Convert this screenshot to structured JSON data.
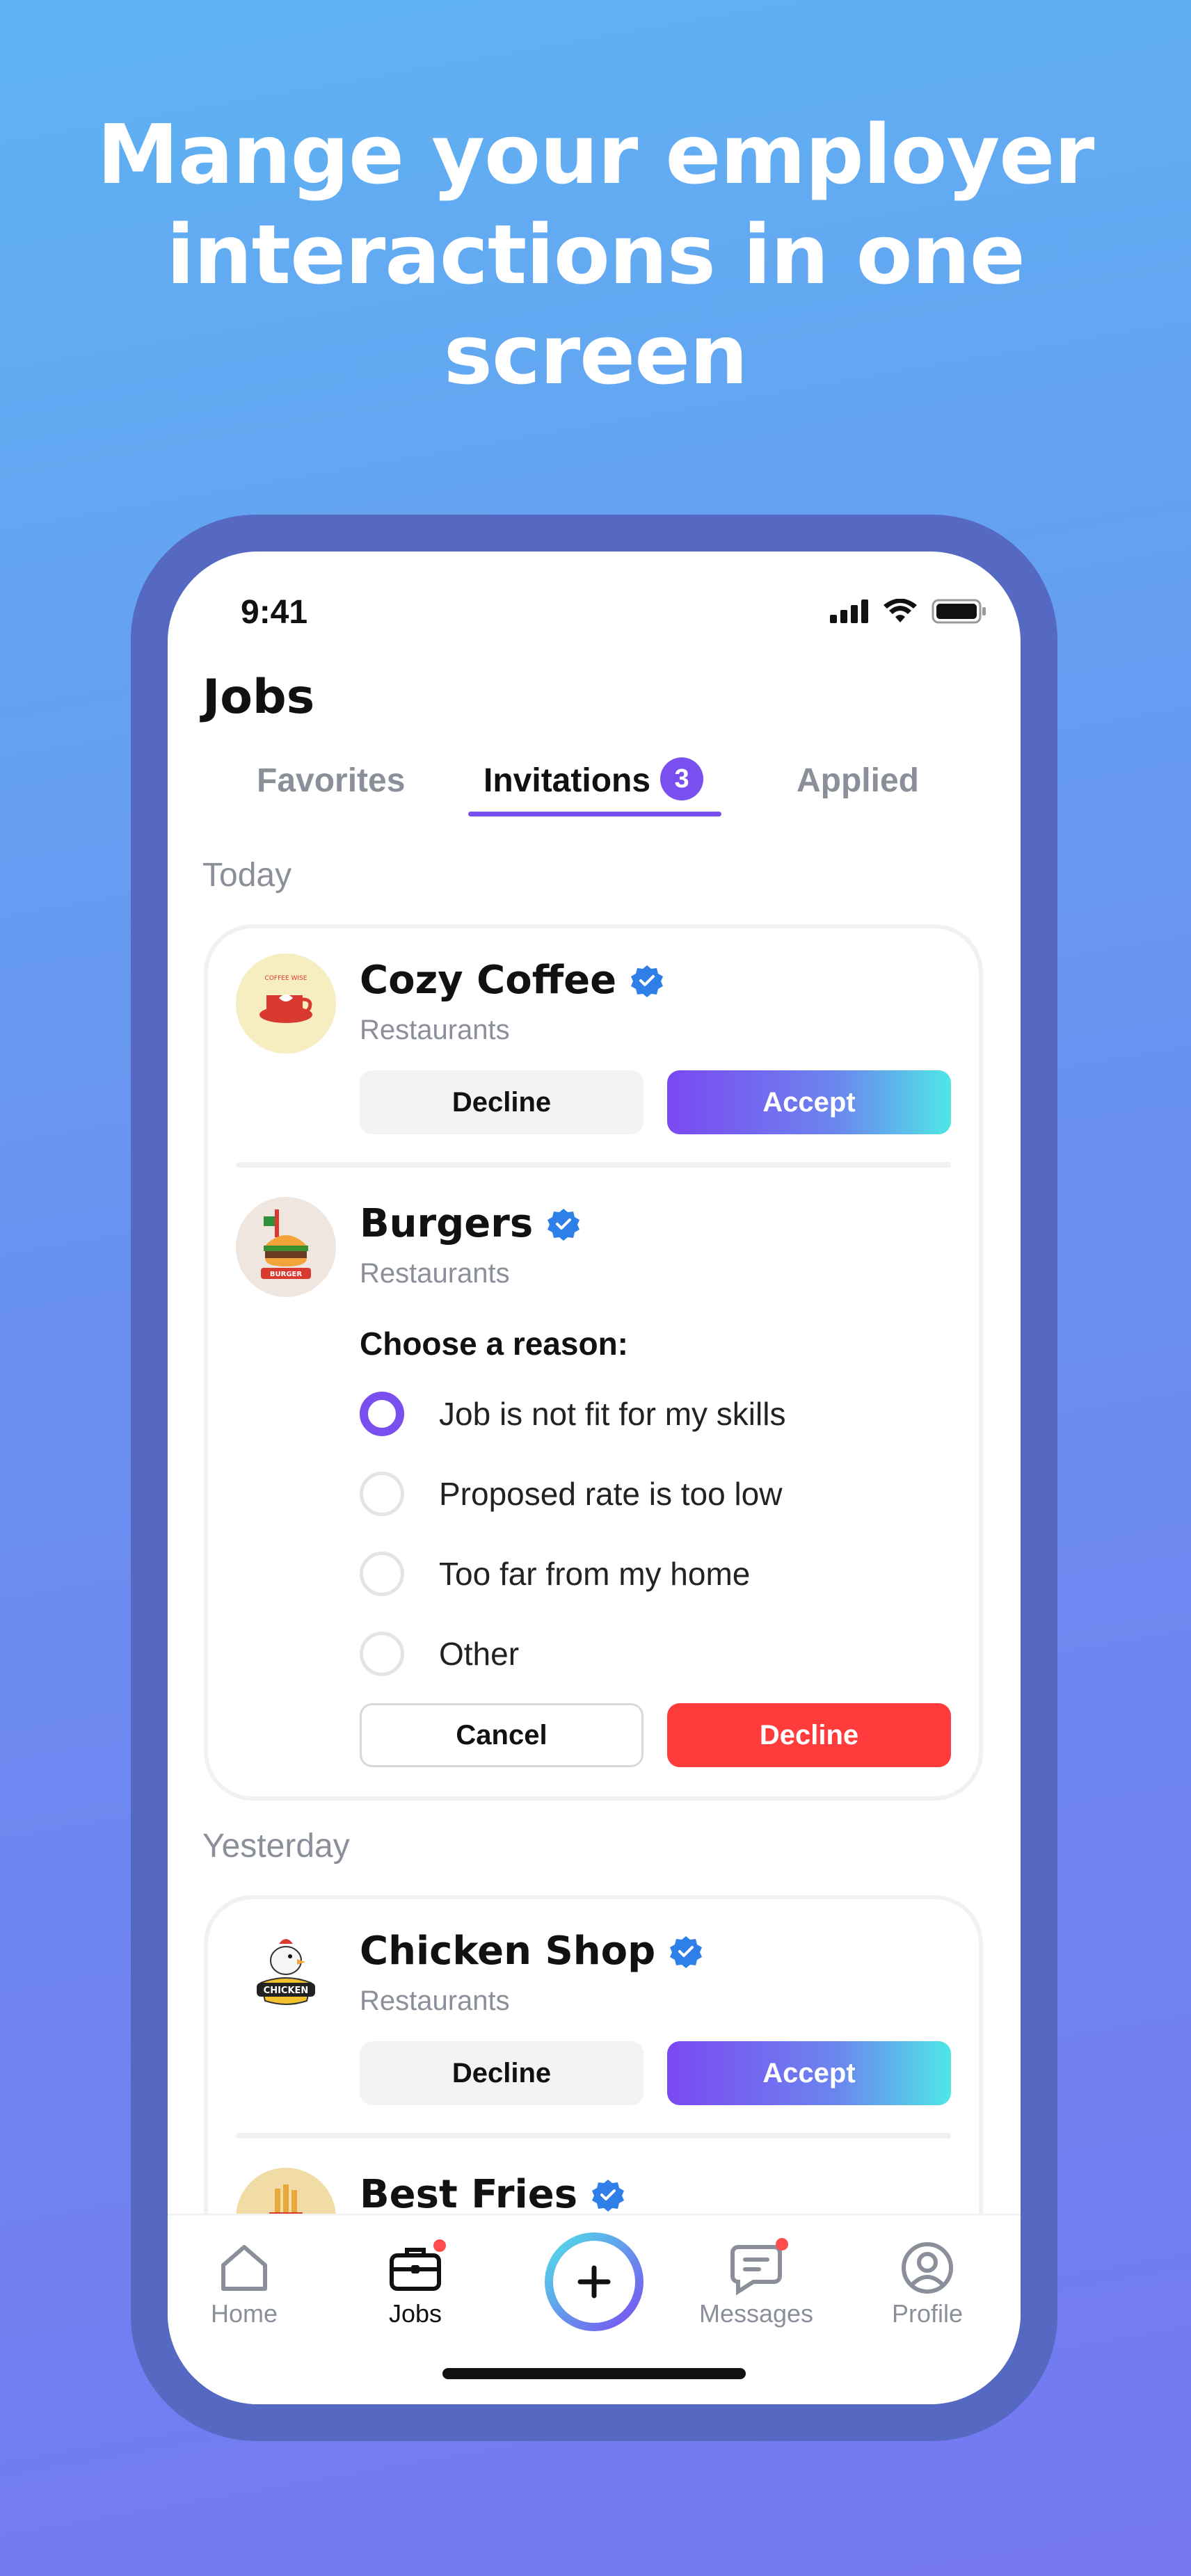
{
  "headline": "Mange your employer interactions in one screen",
  "status_bar": {
    "time": "9:41"
  },
  "page_title": "Jobs",
  "tabs": [
    {
      "label": "Favorites"
    },
    {
      "label": "Invitations",
      "badge": "3"
    },
    {
      "label": "Applied"
    }
  ],
  "sections": {
    "today": "Today",
    "yesterday": "Yesterday"
  },
  "invitations": {
    "cozy_coffee": {
      "name": "Cozy Coffee",
      "category": "Restaurants",
      "decline": "Decline",
      "accept": "Accept",
      "logo_text": "COFFEE WISE"
    },
    "burgers": {
      "name": "Burgers",
      "category": "Restaurants",
      "logo_text": "BURGER",
      "reason_title": "Choose a reason:",
      "reasons": [
        "Job is not fit for my skills",
        "Proposed rate is too low",
        "Too far from my home",
        "Other"
      ],
      "selected_reason": 0,
      "cancel": "Cancel",
      "decline": "Decline"
    },
    "chicken_shop": {
      "name": "Chicken Shop",
      "category": "Restaurants",
      "decline": "Decline",
      "accept": "Accept",
      "logo_text": "CHICKEN"
    },
    "best_fries": {
      "name": "Best Fries"
    }
  },
  "tabbar": {
    "home": "Home",
    "jobs": "Jobs",
    "messages": "Messages",
    "profile": "Profile"
  },
  "colors": {
    "accent": "#7a4ff0",
    "verified": "#2f7fe8",
    "danger": "#ff3b3b"
  }
}
